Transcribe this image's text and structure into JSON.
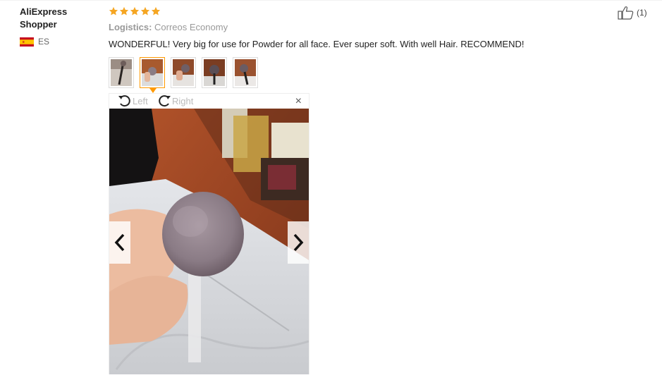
{
  "user": {
    "name": "AliExpress Shopper",
    "country_code": "ES",
    "flag_icon": "spain-flag-icon"
  },
  "review": {
    "rating": 5,
    "max_rating": 5,
    "star_color": "#f5a623",
    "logistics_label": "Logistics:",
    "logistics_value": "Correos Economy",
    "text": "WONDERFUL! Very big for use for Powder for all face. Ever super soft. With well Hair. RECOMMEND!"
  },
  "thumbnails": {
    "count": 5,
    "active_index": 1,
    "accent_color": "#ff9900"
  },
  "viewer": {
    "rotate_left_label": "Left",
    "rotate_right_label": "Right",
    "close_icon": "close-icon",
    "prev_icon": "chevron-left-icon",
    "next_icon": "chevron-right-icon"
  },
  "helpful": {
    "icon": "thumbs-up-icon",
    "count_label": "(1)"
  }
}
